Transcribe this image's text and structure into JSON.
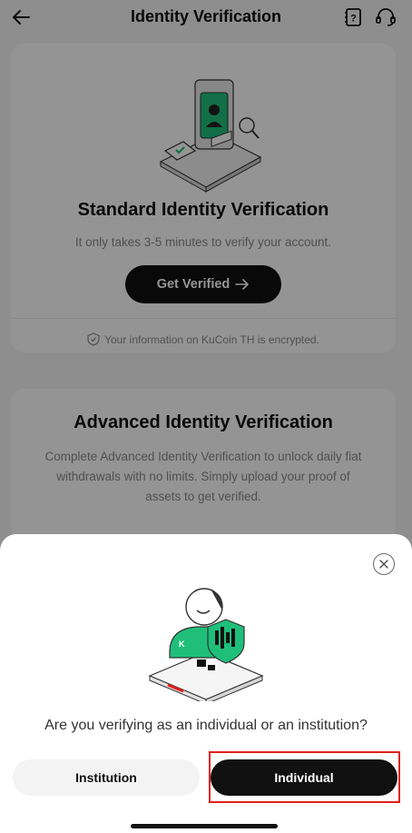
{
  "header": {
    "title": "Identity Verification",
    "back_icon": "arrow-left-icon",
    "help_icon": "help-book-icon",
    "support_icon": "headset-icon"
  },
  "standard_card": {
    "title": "Standard Identity Verification",
    "subtitle": "It only takes 3-5 minutes to verify your account.",
    "button_label": "Get Verified",
    "encrypt_note": "Your information on KuCoin TH is encrypted."
  },
  "advanced_card": {
    "title": "Advanced Identity Verification",
    "subtitle": "Complete Advanced Identity Verification to unlock daily fiat withdrawals with no limits. Simply upload your proof of assets to get verified."
  },
  "sheet": {
    "question": "Are you verifying as an individual or an institution?",
    "options": [
      {
        "label": "Institution",
        "selected": false
      },
      {
        "label": "Individual",
        "selected": true
      }
    ]
  },
  "colors": {
    "brand_green": "#1fbf7a",
    "button_dark": "#111111",
    "highlight_red": "#e0201b"
  }
}
